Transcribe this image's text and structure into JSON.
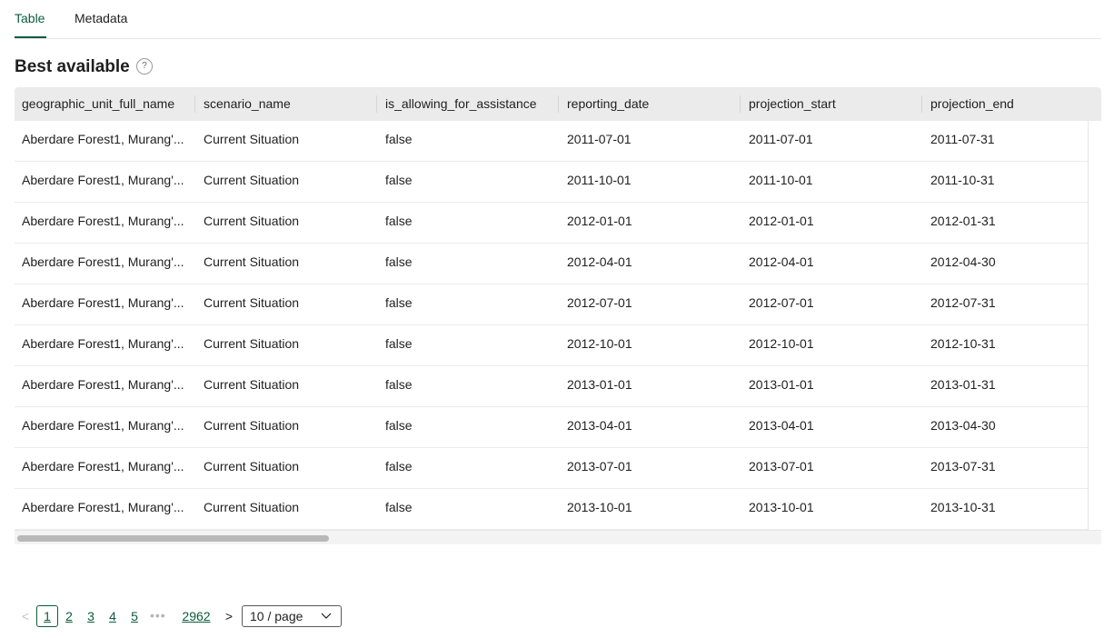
{
  "tabs": [
    {
      "label": "Table",
      "active": true
    },
    {
      "label": "Metadata",
      "active": false
    }
  ],
  "section": {
    "title": "Best available",
    "help_icon": "?"
  },
  "table": {
    "columns": [
      "geographic_unit_full_name",
      "scenario_name",
      "is_allowing_for_assistance",
      "reporting_date",
      "projection_start",
      "projection_end"
    ],
    "rows": [
      [
        "Aberdare Forest1, Murang'...",
        "Current Situation",
        "false",
        "2011-07-01",
        "2011-07-01",
        "2011-07-31"
      ],
      [
        "Aberdare Forest1, Murang'...",
        "Current Situation",
        "false",
        "2011-10-01",
        "2011-10-01",
        "2011-10-31"
      ],
      [
        "Aberdare Forest1, Murang'...",
        "Current Situation",
        "false",
        "2012-01-01",
        "2012-01-01",
        "2012-01-31"
      ],
      [
        "Aberdare Forest1, Murang'...",
        "Current Situation",
        "false",
        "2012-04-01",
        "2012-04-01",
        "2012-04-30"
      ],
      [
        "Aberdare Forest1, Murang'...",
        "Current Situation",
        "false",
        "2012-07-01",
        "2012-07-01",
        "2012-07-31"
      ],
      [
        "Aberdare Forest1, Murang'...",
        "Current Situation",
        "false",
        "2012-10-01",
        "2012-10-01",
        "2012-10-31"
      ],
      [
        "Aberdare Forest1, Murang'...",
        "Current Situation",
        "false",
        "2013-01-01",
        "2013-01-01",
        "2013-01-31"
      ],
      [
        "Aberdare Forest1, Murang'...",
        "Current Situation",
        "false",
        "2013-04-01",
        "2013-04-01",
        "2013-04-30"
      ],
      [
        "Aberdare Forest1, Murang'...",
        "Current Situation",
        "false",
        "2013-07-01",
        "2013-07-01",
        "2013-07-31"
      ],
      [
        "Aberdare Forest1, Murang'...",
        "Current Situation",
        "false",
        "2013-10-01",
        "2013-10-01",
        "2013-10-31"
      ]
    ]
  },
  "pagination": {
    "prev_icon": "<",
    "pages": [
      "1",
      "2",
      "3",
      "4",
      "5"
    ],
    "current_page": "1",
    "ellipsis": "•••",
    "last_page": "2962",
    "next_icon": ">",
    "page_size": "10 / page",
    "page_size_icon": "chevron-down-icon"
  },
  "colors": {
    "accent": "#0b5c3b",
    "header_bg": "#ebebeb"
  }
}
